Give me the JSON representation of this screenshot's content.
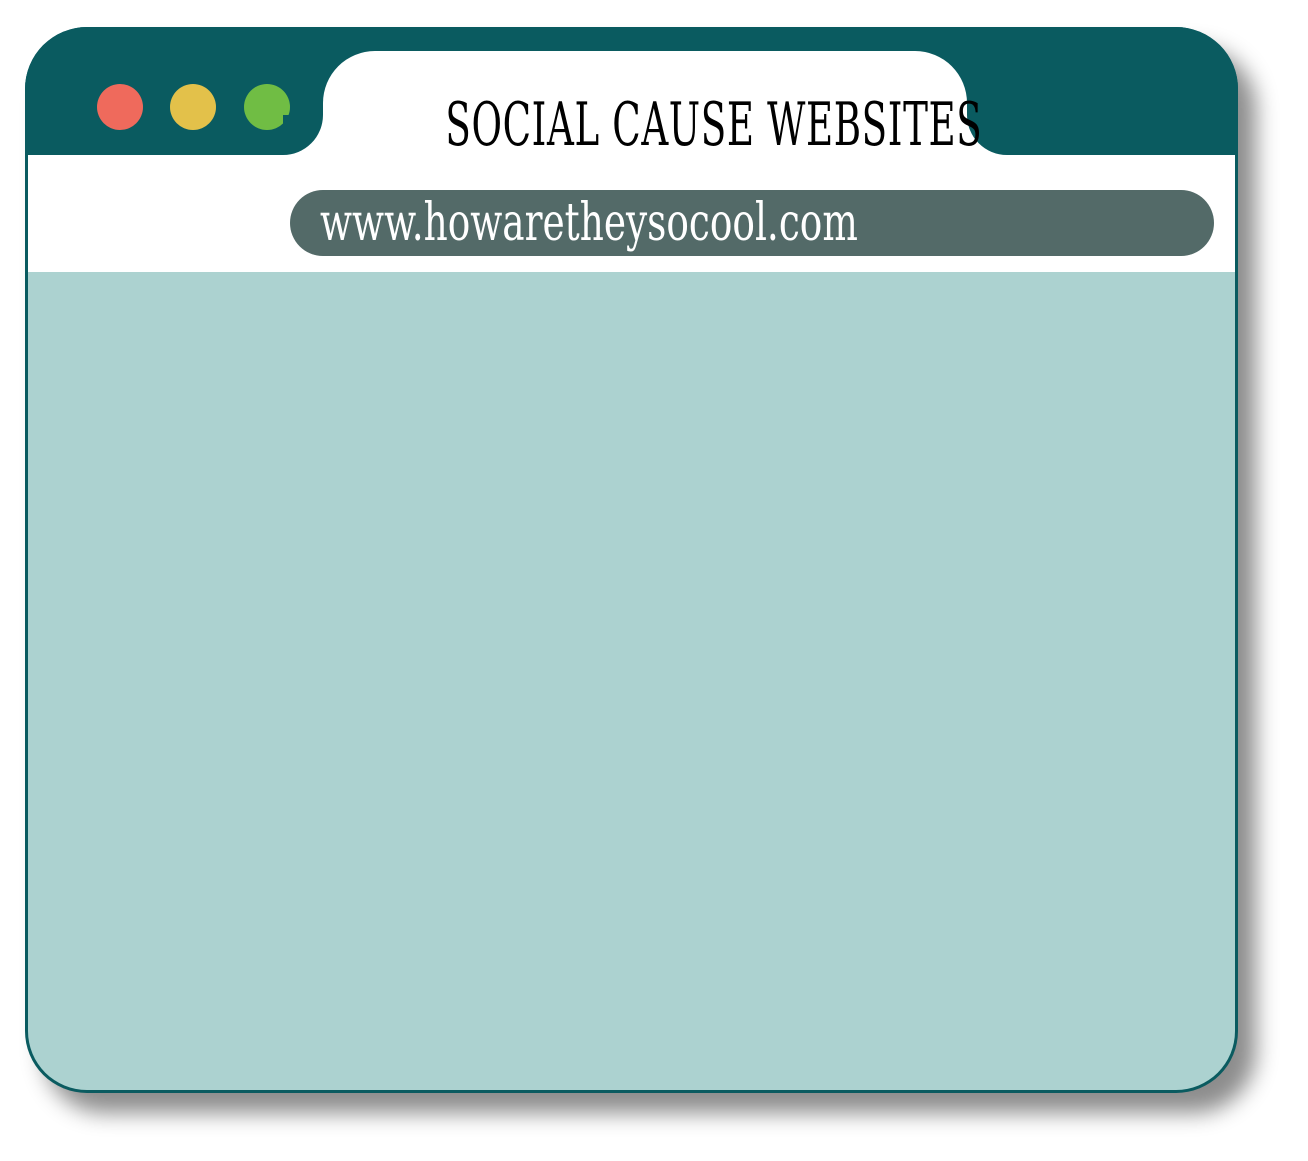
{
  "window": {
    "title": "SOCIAL CAUSE WEBSITES",
    "controls": [
      {
        "name": "close",
        "color": "#ef6a5c"
      },
      {
        "name": "minimize",
        "color": "#e3c14a"
      },
      {
        "name": "maximize",
        "color": "#70bd44"
      }
    ]
  },
  "address_bar": {
    "url": "www.howaretheysocool.com"
  },
  "colors": {
    "frame": "#0a5b60",
    "address_bar": "#536a68",
    "content": "#acd2d0"
  }
}
